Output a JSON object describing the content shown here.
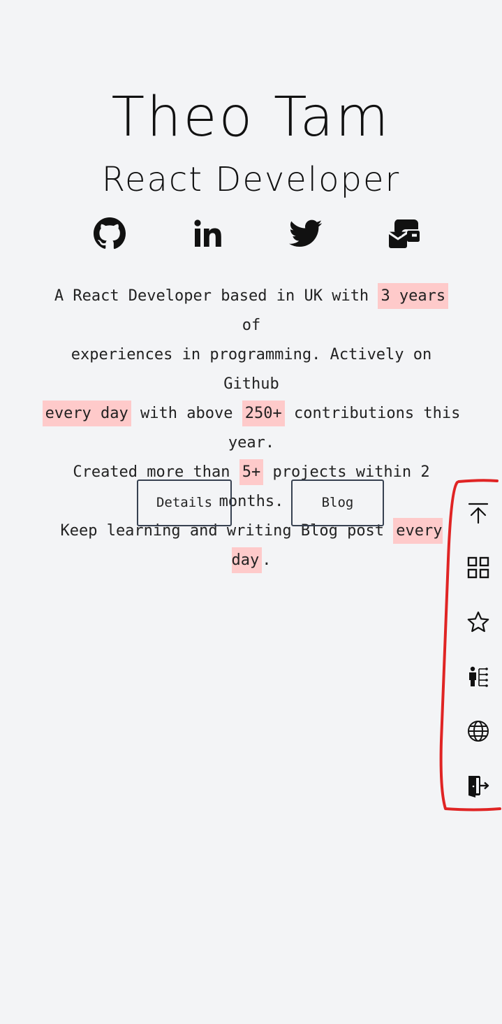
{
  "hero": {
    "name": "Theo Tam",
    "role": "React Developer"
  },
  "social": [
    {
      "icon": "github-icon"
    },
    {
      "icon": "linkedin-icon"
    },
    {
      "icon": "twitter-icon"
    },
    {
      "icon": "email-icon"
    }
  ],
  "bio": {
    "line1_a": "A React Developer based in UK with ",
    "line1_hl": "3 years",
    "line1_b": " of",
    "line2": "experiences in programming. Actively on Github",
    "line3_hl1": "every day",
    "line3_a": " with above ",
    "line3_hl2": "250+",
    "line3_b": " contributions this year.",
    "line4_a": "Created more than ",
    "line4_hl": "5+",
    "line4_b": " projects within 2 months.",
    "line5_a": "Keep learning and writing Blog post ",
    "line5_hl": "every day",
    "line5_b": "."
  },
  "buttons": {
    "details_label": "Details",
    "blog_label": "Blog"
  },
  "sidebar": {
    "items": [
      {
        "icon": "arrow-to-top-icon"
      },
      {
        "icon": "grid-icon"
      },
      {
        "icon": "star-icon"
      },
      {
        "icon": "sitemap-person-icon"
      },
      {
        "icon": "globe-icon"
      },
      {
        "icon": "logout-door-icon"
      }
    ]
  },
  "colors": {
    "background": "#f3f4f6",
    "highlight": "#fecaca",
    "button_border": "#374151",
    "annotation": "#e02424"
  }
}
